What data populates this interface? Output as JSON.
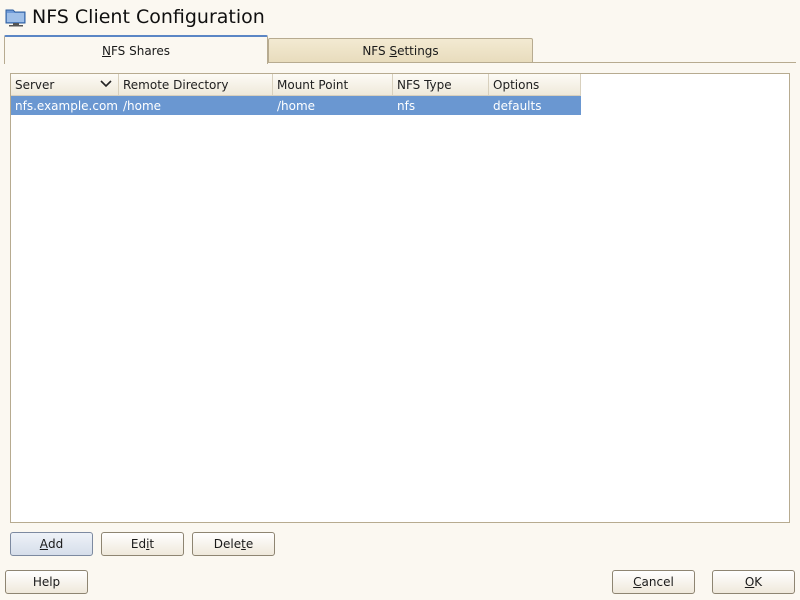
{
  "window": {
    "title": "NFS Client Configuration",
    "icon": "folder-network-icon"
  },
  "tabs": [
    {
      "label_pre": "",
      "label_mnemonic": "N",
      "label_post": "FS Shares",
      "active": true
    },
    {
      "label_pre": "NFS ",
      "label_mnemonic": "S",
      "label_post": "ettings",
      "active": false
    }
  ],
  "table": {
    "columns": [
      "Server",
      "Remote Directory",
      "Mount Point",
      "NFS Type",
      "Options"
    ],
    "sort_column": "Server",
    "rows": [
      {
        "server": "nfs.example.com",
        "remote_directory": "/home",
        "mount_point": "/home",
        "nfs_type": "nfs",
        "options": "defaults",
        "selected": true
      }
    ]
  },
  "buttons": {
    "add": {
      "pre": "",
      "mnemonic": "A",
      "post": "dd"
    },
    "edit": {
      "pre": "Ed",
      "mnemonic": "i",
      "post": "t"
    },
    "delete": {
      "pre": "Dele",
      "mnemonic": "t",
      "post": "e"
    },
    "help": {
      "pre": "Help",
      "mnemonic": "",
      "post": ""
    },
    "cancel": {
      "pre": "",
      "mnemonic": "C",
      "post": "ancel"
    },
    "ok": {
      "pre": "",
      "mnemonic": "O",
      "post": "K"
    }
  },
  "colors": {
    "selection": "#6a97d1",
    "tab_accent": "#5b86c5",
    "background": "#fbf8f1"
  }
}
